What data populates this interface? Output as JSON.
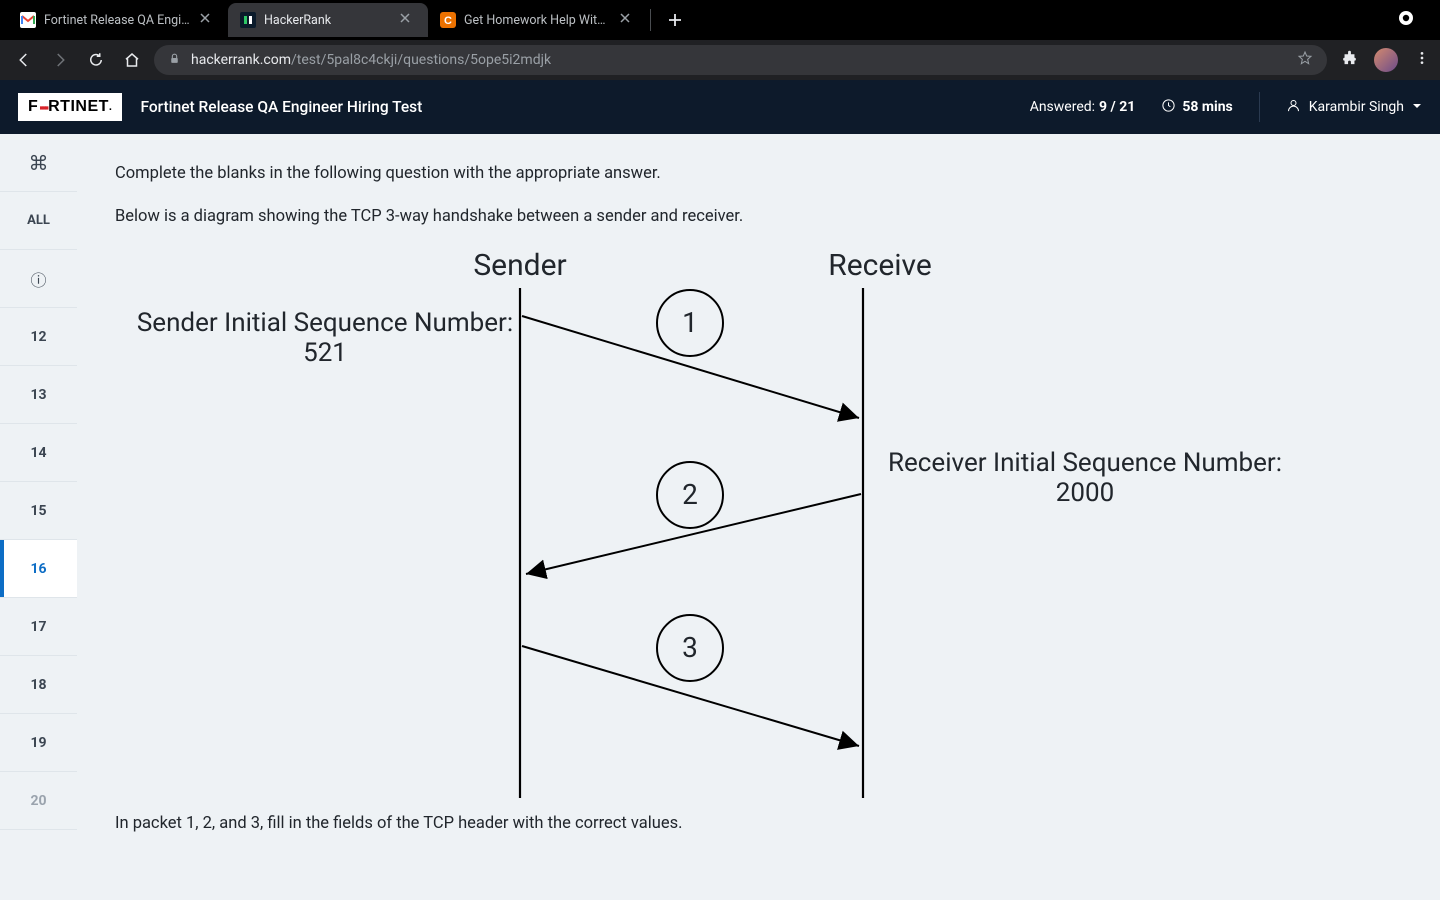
{
  "browser": {
    "tabs": [
      {
        "title": "Fortinet Release QA Engineer H",
        "favicon": "gmail",
        "active": false
      },
      {
        "title": "HackerRank",
        "favicon": "hackerrank",
        "active": true
      },
      {
        "title": "Get Homework Help With Cheg",
        "favicon": "chegg",
        "active": false
      }
    ],
    "url_host": "hackerrank.com",
    "url_path": "/test/5pal8c4ckji/questions/5ope5i2mdjk"
  },
  "header": {
    "logo_text_1": "F",
    "logo_text_2": "RTINET",
    "logo_dots": "::",
    "test_title": "Fortinet Release QA Engineer Hiring Test",
    "answered_label": "Answered:",
    "answered_value": "9 / 21",
    "time_value": "58 mins",
    "user_name": "Karambir Singh"
  },
  "sidebar": {
    "cmd_icon": "⌘",
    "all_label": "ALL",
    "info_icon": "ⓘ",
    "items": [
      "12",
      "13",
      "14",
      "15",
      "16",
      "17",
      "18",
      "19",
      "20"
    ],
    "active": "16"
  },
  "question": {
    "line1": "Complete the blanks in the following question with the appropriate answer.",
    "line2": "Below is a diagram showing the TCP 3-way handshake between a sender and receiver.",
    "line3": "In packet 1, 2, and 3, fill in the fields of the TCP header with the correct values."
  },
  "diagram": {
    "sender_label": "Sender",
    "receiver_label": "Receive",
    "sender_isn_label": "Sender Initial Sequence Number:",
    "sender_isn_value": "521",
    "receiver_isn_label": "Receiver Initial Sequence Number:",
    "receiver_isn_value": "2000",
    "packets": [
      "1",
      "2",
      "3"
    ]
  }
}
